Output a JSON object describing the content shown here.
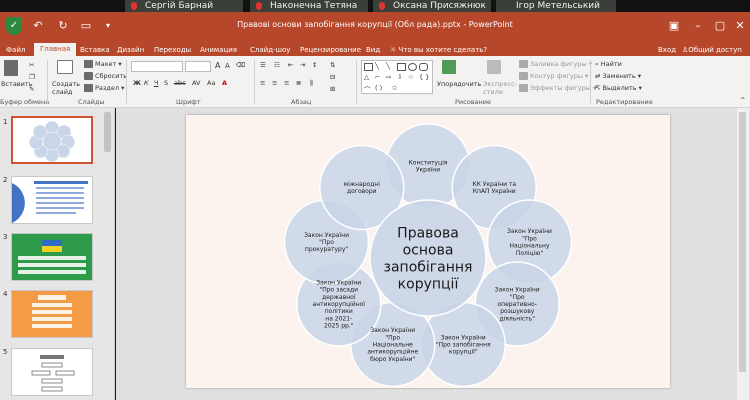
{
  "participants": [
    {
      "name": "Сергій Барнай"
    },
    {
      "name": "Наконечна Тетяна"
    },
    {
      "name": "Оксана Присяжнюк"
    },
    {
      "name": "Ігор Метельський"
    }
  ],
  "window": {
    "title": "Правові основи запобігання корупції (Обл рада).pptx - PowerPoint"
  },
  "tabs": [
    "Файл",
    "Главная",
    "Вставка",
    "Дизайн",
    "Переходы",
    "Анимация",
    "Слайд-шоу",
    "Рецензирование",
    "Вид"
  ],
  "tell_me": "Что вы хотите сделать?",
  "account": {
    "sign_in": "Вход",
    "share": "Общий доступ"
  },
  "ribbon": {
    "paste": "Вставить",
    "clipboard_group": "Буфер обмена",
    "new_slide": "Создать слайд",
    "layout": "Макет",
    "reset": "Сбросить",
    "section": "Раздел",
    "slides_group": "Слайды",
    "font_group": "Шрифт",
    "paragraph_group": "Абзац",
    "arrange": "Упорядочить",
    "quick_styles": "Экспресс-стили",
    "shape_fill": "Заливка фигуры",
    "shape_outline": "Контур фигуры",
    "shape_effects": "Эффекты фигуры",
    "drawing_group": "Рисование",
    "find": "Найти",
    "replace": "Заменить",
    "select": "Выделить",
    "editing_group": "Редактирование"
  },
  "thumbnails": [
    "1",
    "2",
    "3",
    "4",
    "5"
  ],
  "slide": {
    "center": [
      "Правова",
      "основа",
      "запобігання",
      "корупції"
    ],
    "petals": [
      [
        "Конституція",
        "України"
      ],
      [
        "КК України та",
        "КпАП України"
      ],
      [
        "Закон України",
        "\"Про",
        "Національну",
        "Поліцію\""
      ],
      [
        "Закон України",
        "\"Про",
        "оперативно-",
        "розшукову",
        "діяльність\""
      ],
      [
        "Закон України",
        "\"Про запобігання",
        "корупції\""
      ],
      [
        "Закон України",
        "\"Про",
        "Національне",
        "антикорупційне",
        "бюро України\""
      ],
      [
        "Закон України",
        "\"Про засади",
        "державної",
        "антикорупційної",
        "політики",
        "на 2021-",
        "2025 рр.\""
      ],
      [
        "Закон України",
        "\"Про",
        "прокуратуру\""
      ],
      [
        "міжнародні",
        "договори"
      ]
    ]
  },
  "colors": {
    "accent": "#b7472a",
    "circle_fill": "#c9d5e8",
    "circle_stroke": "#ffffff"
  }
}
